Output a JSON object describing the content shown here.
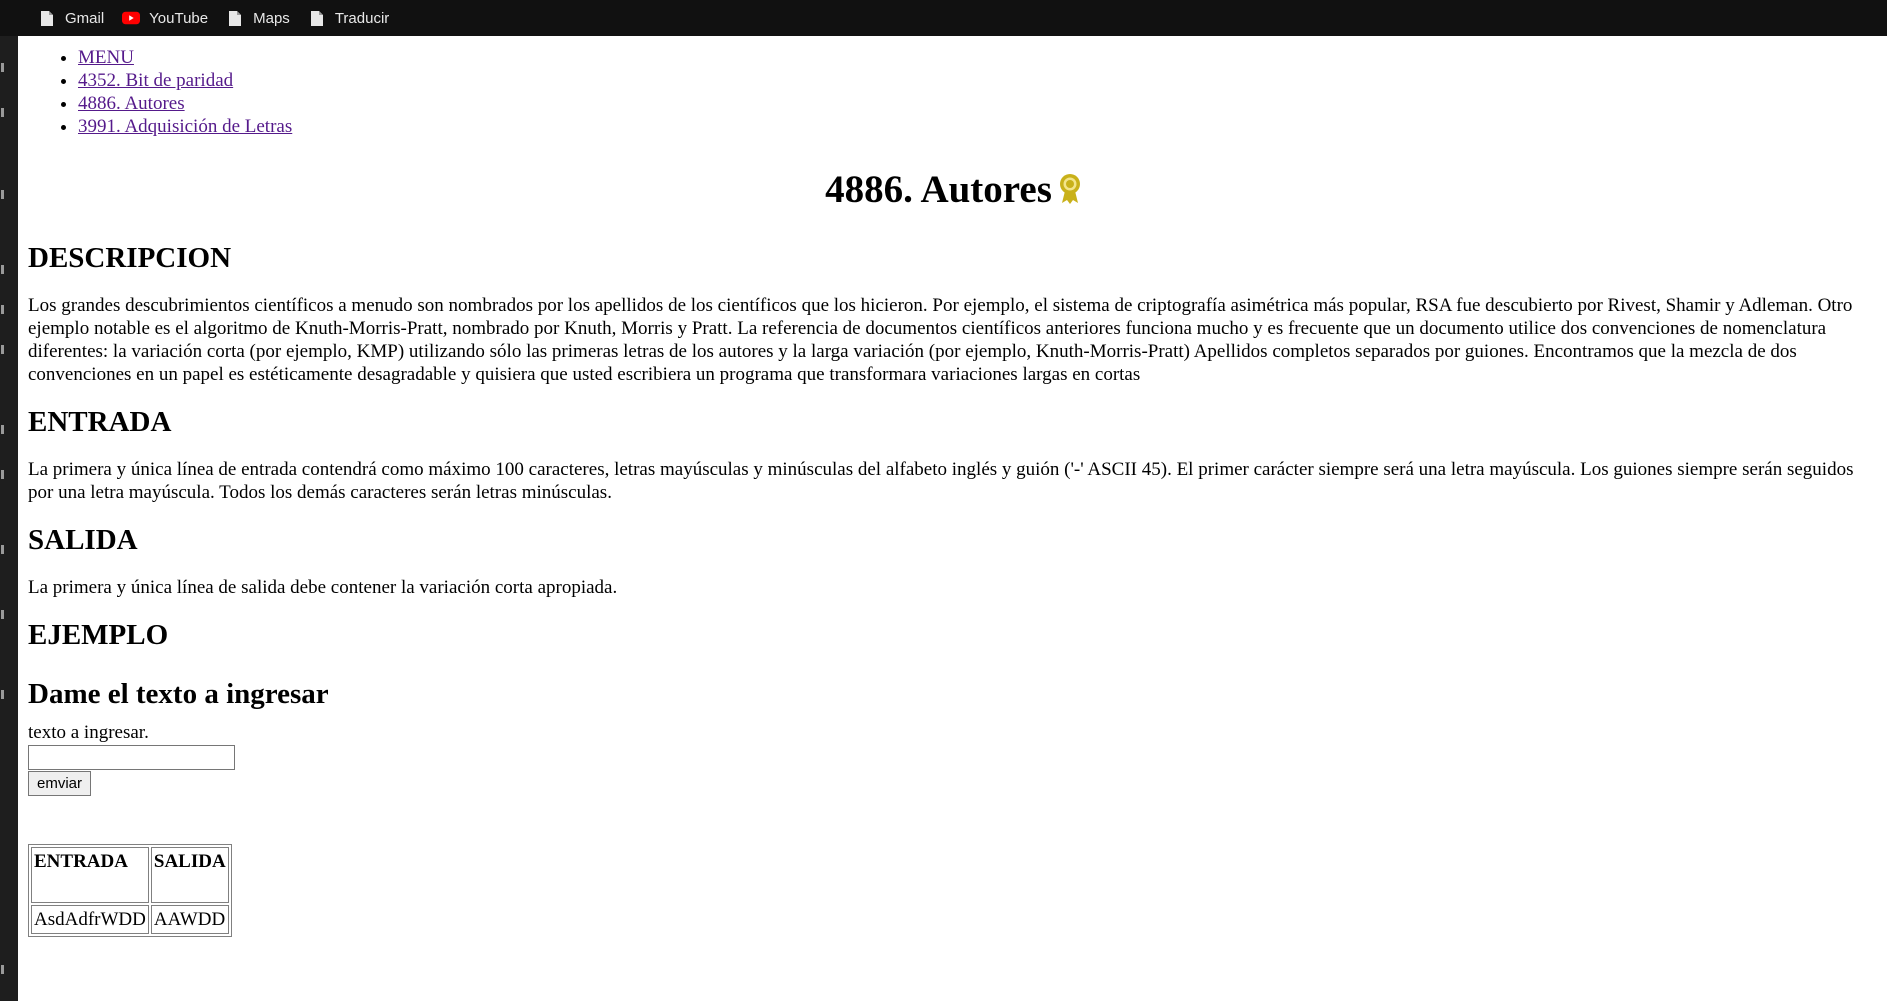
{
  "bookmarks": [
    {
      "label": "Gmail",
      "icon": "page-icon"
    },
    {
      "label": "YouTube",
      "icon": "youtube-icon"
    },
    {
      "label": "Maps",
      "icon": "page-icon"
    },
    {
      "label": "Traducir",
      "icon": "page-icon"
    }
  ],
  "menu": [
    "MENU",
    "4352. Bit de paridad",
    "4886. Autores",
    "3991. Adquisición de Letras"
  ],
  "title": "4886. Autores",
  "sections": {
    "descripcion": {
      "heading": "DESCRIPCION",
      "text": "Los grandes descubrimientos científicos a menudo son nombrados por los apellidos de los científicos que los hicieron. Por ejemplo, el sistema de criptografía asimétrica más popular, RSA fue descubierto por Rivest, Shamir y Adleman. Otro ejemplo notable es el algoritmo de Knuth-Morris-Pratt, nombrado por Knuth, Morris y Pratt. La referencia de documentos científicos anteriores funciona mucho y es frecuente que un documento utilice dos convenciones de nomenclatura diferentes: la variación corta (por ejemplo, KMP) utilizando sólo las primeras letras de los autores y la larga variación (por ejemplo, Knuth-Morris-Pratt) Apellidos completos separados por guiones. Encontramos que la mezcla de dos convenciones en un papel es estéticamente desagradable y quisiera que usted escribiera un programa que transformara variaciones largas en cortas"
    },
    "entrada": {
      "heading": "ENTRADA",
      "text": "La primera y única línea de entrada contendrá como máximo 100 caracteres, letras mayúsculas y minúsculas del alfabeto inglés y guión ('-' ASCII 45). El primer carácter siempre será una letra mayúscula. Los guiones siempre serán seguidos por una letra mayúscula. Todos los demás caracteres serán letras minúsculas."
    },
    "salida": {
      "heading": "SALIDA",
      "text": "La primera y única línea de salida debe contener la variación corta apropiada."
    },
    "ejemplo": {
      "heading": "EJEMPLO"
    }
  },
  "form": {
    "heading": "Dame el texto a ingresar",
    "label": "texto a ingresar.",
    "input_value": "",
    "button": "emviar"
  },
  "example_table": {
    "headers": [
      "ENTRADA",
      "SALIDA"
    ],
    "rows": [
      [
        "AsdAdfrWDD",
        "AAWDD"
      ]
    ]
  },
  "colors": {
    "bookmark_bar": "#111111",
    "visited_link": "#551a8b",
    "award": "#c9b11a",
    "youtube": "#ff0000"
  }
}
